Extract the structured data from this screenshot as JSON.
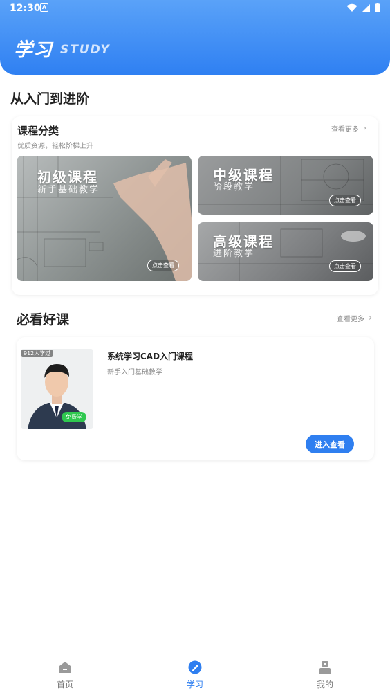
{
  "status_bar": {
    "time": "12:30",
    "notification_icon": "A"
  },
  "header": {
    "title_cn": "学习",
    "title_en": "STUDY"
  },
  "section_title": "从入门到进阶",
  "category_card": {
    "title": "课程分类",
    "subtitle": "优质资源，轻松阶梯上升",
    "more_label": "查看更多",
    "tiles": [
      {
        "name": "初级课程",
        "desc": "新手基础教学",
        "button": "点击查看"
      },
      {
        "name": "中级课程",
        "desc": "阶段教学",
        "button": "点击查看"
      },
      {
        "name": "高级课程",
        "desc": "进阶教学",
        "button": "点击查看"
      }
    ]
  },
  "recommend": {
    "title": "必看好课",
    "more_label": "查看更多",
    "course": {
      "learned_badge": "912人学过",
      "free_tag": "免费学",
      "title": "系统学习CAD入门课程",
      "subtitle": "新手入门基础教学",
      "enter_button": "进入查看"
    }
  },
  "bottom_nav": {
    "items": [
      {
        "label": "首页",
        "icon": "home-icon",
        "active": false
      },
      {
        "label": "学习",
        "icon": "study-icon",
        "active": true
      },
      {
        "label": "我的",
        "icon": "profile-icon",
        "active": false
      }
    ]
  },
  "colors": {
    "primary": "#2f7ff0",
    "nav_inactive": "#777777",
    "free_green": "#2fc84f"
  }
}
